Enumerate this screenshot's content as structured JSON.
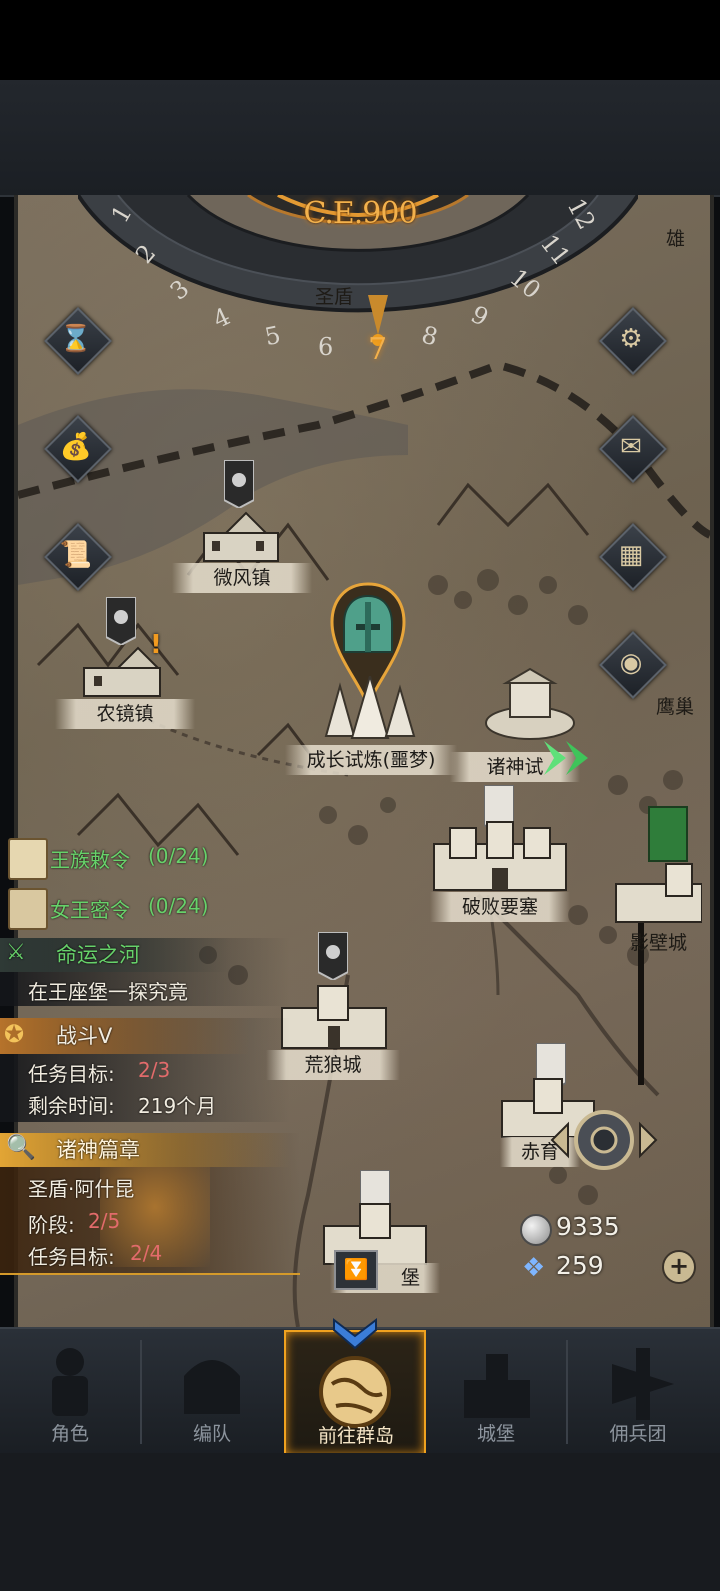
{
  "year": "C.E.900",
  "dial": {
    "current_month": "7",
    "left_numbers": [
      "1",
      "2",
      "3",
      "4",
      "5",
      "6"
    ],
    "right_numbers": [
      "8",
      "9",
      "10",
      "11",
      "12"
    ],
    "top_city": "圣盾"
  },
  "side_buttons": {
    "left": [
      {
        "name": "hourglass-icon",
        "glyph": "⌛"
      },
      {
        "name": "money-bag-icon",
        "glyph": "💰"
      },
      {
        "name": "scroll-icon",
        "glyph": "📜"
      }
    ],
    "right": [
      {
        "name": "gear-icon",
        "glyph": "⚙"
      },
      {
        "name": "mail-icon",
        "glyph": "✉"
      },
      {
        "name": "window-icon",
        "glyph": "▦"
      },
      {
        "name": "coin-icon",
        "glyph": "◉"
      }
    ]
  },
  "locations": {
    "weifeng": "微风镇",
    "nongjing": "农镜镇",
    "trial": "成长试炼(噩梦)",
    "gods": "诸神试",
    "ruined_fortress": "破败要塞",
    "wolf_city": "荒狼城",
    "red_city": "赤育",
    "fortress_bottom": "堡",
    "shadow_city": "影壁城",
    "eagle": "鹰巢",
    "hero": "雄"
  },
  "quests": {
    "royal_decree": "王族敕令",
    "royal_decree_progress": "(0/24)",
    "queen_secret": "女王密令",
    "queen_secret_progress": "(0/24)",
    "river_title": "命运之河",
    "river_desc": "在王座堡一探究竟",
    "battle_title": "战斗V",
    "battle_goal_label": "任务目标:",
    "battle_goal_value": "2/3",
    "battle_time_label": "剩余时间:",
    "battle_time_value": "219个月",
    "gods_title": "诸神篇章",
    "gods_hero": "圣盾·阿什昆",
    "gods_stage_label": "阶段:",
    "gods_stage_value": "2/5",
    "gods_goal_label": "任务目标:",
    "gods_goal_value": "2/4"
  },
  "resources": {
    "silver": "9335",
    "crystal": "259"
  },
  "nav": [
    {
      "label": "角色"
    },
    {
      "label": "编队"
    },
    {
      "label": "前往群岛"
    },
    {
      "label": "城堡"
    },
    {
      "label": "佣兵团"
    }
  ],
  "colors": {
    "accent_orange": "#f0a21f",
    "quest_green": "#67d26a",
    "progress_red": "#e26b6b"
  }
}
